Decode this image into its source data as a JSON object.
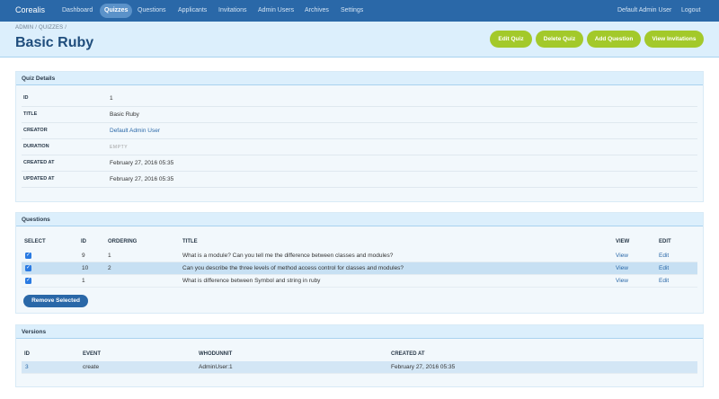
{
  "nav": {
    "brand": "Corealis",
    "items": [
      {
        "label": "Dashboard"
      },
      {
        "label": "Quizzes"
      },
      {
        "label": "Questions"
      },
      {
        "label": "Applicants"
      },
      {
        "label": "Invitations"
      },
      {
        "label": "Admin Users"
      },
      {
        "label": "Archives"
      },
      {
        "label": "Settings"
      }
    ],
    "user": "Default Admin User",
    "logout": "Logout"
  },
  "header": {
    "breadcrumb": [
      "ADMIN",
      "/",
      "QUIZZES",
      "/"
    ],
    "title": "Basic Ruby",
    "actions": [
      {
        "label": "Edit Quiz"
      },
      {
        "label": "Delete Quiz"
      },
      {
        "label": "Add Question"
      },
      {
        "label": "View Invitations"
      }
    ]
  },
  "quiz_details": {
    "title": "Quiz Details",
    "rows": [
      {
        "label": "ID",
        "value": "1"
      },
      {
        "label": "TITLE",
        "value": "Basic Ruby"
      },
      {
        "label": "CREATOR",
        "value": "Default Admin User"
      },
      {
        "label": "DURATION",
        "value": "EMPTY"
      },
      {
        "label": "CREATED AT",
        "value": "February 27, 2016 05:35"
      },
      {
        "label": "UPDATED AT",
        "value": "February 27, 2016 05:35"
      }
    ]
  },
  "questions": {
    "title": "Questions",
    "columns": [
      "SELECT",
      "ID",
      "ORDERING",
      "TITLE",
      "VIEW",
      "EDIT"
    ],
    "rows": [
      {
        "id": "9",
        "ordering": "1",
        "title": "What is a module? Can you tell me the difference between classes and modules?",
        "view": "View",
        "edit": "Edit",
        "selected": true
      },
      {
        "id": "10",
        "ordering": "2",
        "title": "Can you describe the three levels of method access control for classes and modules?",
        "view": "View",
        "edit": "Edit",
        "selected": true
      },
      {
        "id": "1",
        "ordering": "",
        "title": "What is difference between Symbol and string in ruby",
        "view": "View",
        "edit": "Edit",
        "selected": true
      }
    ],
    "remove_label": "Remove Selected",
    "checkmark": "✓"
  },
  "versions": {
    "title": "Versions",
    "columns": [
      "ID",
      "EVENT",
      "WHODUNNIT",
      "CREATED AT"
    ],
    "rows": [
      {
        "id": "3",
        "event": "create",
        "whodunnit": "AdminUser:1",
        "created_at": "February 27, 2016 05:35"
      }
    ]
  },
  "colors": {
    "nav_bg": "#2a68a8",
    "accent_green": "#a3c92a",
    "header_bg": "#dceffc",
    "link": "#2a68a8"
  }
}
